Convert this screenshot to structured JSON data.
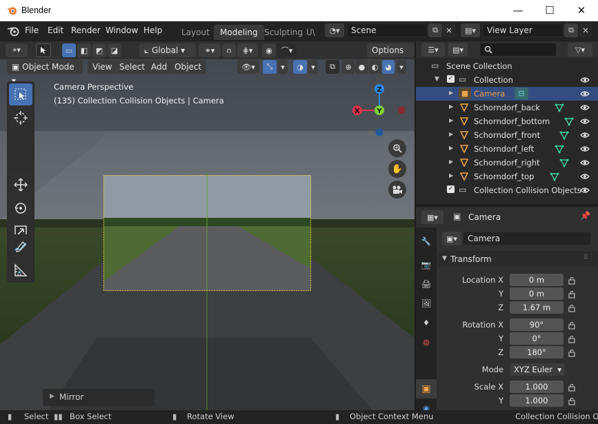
{
  "app": {
    "title": "Blender"
  },
  "window_controls": {
    "minimize": "—",
    "maximize": "☐",
    "close": "✕"
  },
  "menus": [
    "File",
    "Edit",
    "Render",
    "Window",
    "Help"
  ],
  "workspaces": [
    {
      "label": "Layout",
      "active": false
    },
    {
      "label": "Modeling",
      "active": true
    },
    {
      "label": "Sculpting",
      "active": false
    },
    {
      "label": "U\\",
      "active": false
    }
  ],
  "scene": {
    "value": "Scene"
  },
  "view_layer": {
    "value": "View Layer"
  },
  "viewport": {
    "transform_orientation": "Global",
    "options_label": "Options",
    "mode": "Object Mode",
    "menus": [
      "View",
      "Select",
      "Add",
      "Object"
    ],
    "overlay_text": {
      "line1": "Camera Perspective",
      "line2": "(135) Collection Collision Objects | Camera"
    },
    "gizmo_axes": {
      "x": "X",
      "y": "Y",
      "z": "Z"
    },
    "last_operator": "Mirror"
  },
  "outliner": {
    "root": "Scene Collection",
    "collection": "Collection",
    "items": [
      {
        "label": "Camera",
        "selected": true
      },
      {
        "label": "Schorndorf_back",
        "selected": false
      },
      {
        "label": "Schorndorf_bottom",
        "selected": false
      },
      {
        "label": "Schorndorf_front",
        "selected": false
      },
      {
        "label": "Schorndorf_left",
        "selected": false
      },
      {
        "label": "Schorndorf_right",
        "selected": false
      },
      {
        "label": "Schorndorf_top",
        "selected": false
      }
    ],
    "collection2": "Collection Collision Objects"
  },
  "properties": {
    "header_title": "Camera",
    "object_name": "Camera",
    "panel_title": "Transform",
    "location": {
      "label": "Location X",
      "x": "0 m",
      "y": "0 m",
      "z": "1.67 m"
    },
    "rotation": {
      "label": "Rotation X",
      "x": "90°",
      "y": "0°",
      "z": "180°"
    },
    "mode": {
      "label": "Mode",
      "value": "XYZ Euler"
    },
    "scale": {
      "label": "Scale X",
      "x": "1.000",
      "y": "1.000"
    },
    "axis_labels": {
      "y": "Y",
      "z": "Z"
    }
  },
  "statusbar": {
    "select": "Select",
    "box_select": "Box Select",
    "rotate_view": "Rotate View",
    "context_menu": "Object Context Menu",
    "right_text": "Collection Collision Obj"
  },
  "colors": {
    "accent": "#4772b3",
    "selected_row": "#334d80",
    "camera_orange": "#e8a04a",
    "axis_x": "#e8314e",
    "axis_y": "#7bd332",
    "axis_z": "#2e87e8"
  }
}
